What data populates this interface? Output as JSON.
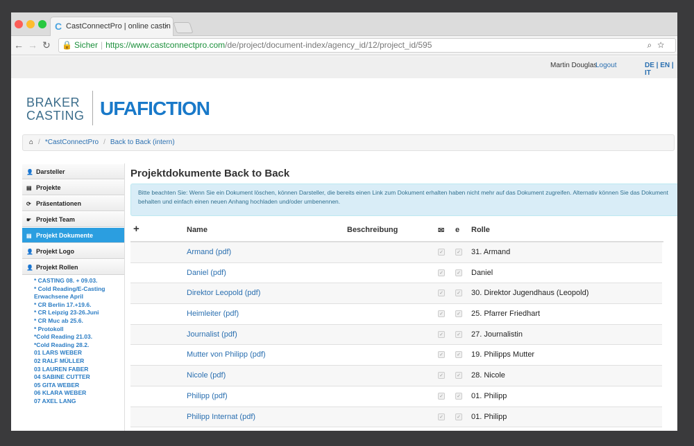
{
  "browser": {
    "tab_title": "CastConnectPro | online castin",
    "tab_close": "×",
    "secure_label": "Sicher",
    "url_host": "https://www.castconnectpro.com",
    "url_path": "/de/project/document-index/agency_id/12/project_id/595"
  },
  "topbar": {
    "user_name": "Martin Douglas",
    "logout_label": "Logout",
    "languages": "DE | EN | IT"
  },
  "logos": {
    "braker_line1": "BRAKER",
    "braker_line2": "CASTING",
    "ufa_part1": "UFA",
    "ufa_part2": "FICTION"
  },
  "breadcrumb": {
    "item1": "*CastConnectPro",
    "item2": "Back to Back (intern)"
  },
  "sidebar": {
    "items": [
      {
        "icon": "👤",
        "label": "Darsteller"
      },
      {
        "icon": "▤",
        "label": "Projekte"
      },
      {
        "icon": "⟳",
        "label": "Präsentationen"
      },
      {
        "icon": "☛",
        "label": "Projekt Team"
      },
      {
        "icon": "▤",
        "label": "Projekt Dokumente"
      },
      {
        "icon": "👤",
        "label": "Projekt Logo"
      },
      {
        "icon": "👤",
        "label": "Projekt Rollen"
      }
    ],
    "active_index": 4,
    "sub_items": [
      "* CASTING 08. + 09.03.",
      "* Cold Reading/E-Casting",
      "Erwachsene April",
      "* CR Berlin 17.+19.6.",
      "* CR Leipzig 23-26.Juni",
      "* CR Muc ab 25.6.",
      "* Protokoll",
      "*Cold Reading 21.03.",
      "*Cold Reading 28.2.",
      "01 LARS WEBER",
      "02 RALF MÜLLER",
      "03 LAUREN FABER",
      "04 SABINE CUTTER",
      "05 GITA WEBER",
      "06 KLARA WEBER",
      "07 AXEL LANG"
    ]
  },
  "content": {
    "title": "Projektdokumente Back to Back",
    "alert": "Bitte beachten Sie: Wenn Sie ein Dokument löschen, können Darsteller, die bereits einen Link zum Dokument erhalten haben nicht mehr auf das Dokument zugreifen. Alternativ können Sie das Dokument behalten und einfach einen neuen Anhang hochladen und/oder umbenennen.",
    "table": {
      "add_symbol": "+",
      "col_name": "Name",
      "col_description": "Beschreibung",
      "col_mail_icon": "✉",
      "col_e": "e",
      "col_role": "Rolle",
      "rows": [
        {
          "name": "Armand (pdf)",
          "role": "31. Armand"
        },
        {
          "name": "Daniel (pdf)",
          "role": "Daniel"
        },
        {
          "name": "Direktor Leopold (pdf)",
          "role": "30. Direktor Jugendhaus (Leopold)"
        },
        {
          "name": "Heimleiter (pdf)",
          "role": "25. Pfarrer Friedhart"
        },
        {
          "name": "Journalist (pdf)",
          "role": "27. Journalistin"
        },
        {
          "name": "Mutter von Philipp (pdf)",
          "role": "19. Philipps Mutter"
        },
        {
          "name": "Nicole (pdf)",
          "role": "28. Nicole"
        },
        {
          "name": "Philipp (pdf)",
          "role": "01. Philipp"
        },
        {
          "name": "Philipp Internat (pdf)",
          "role": "01. Philipp"
        }
      ]
    }
  }
}
